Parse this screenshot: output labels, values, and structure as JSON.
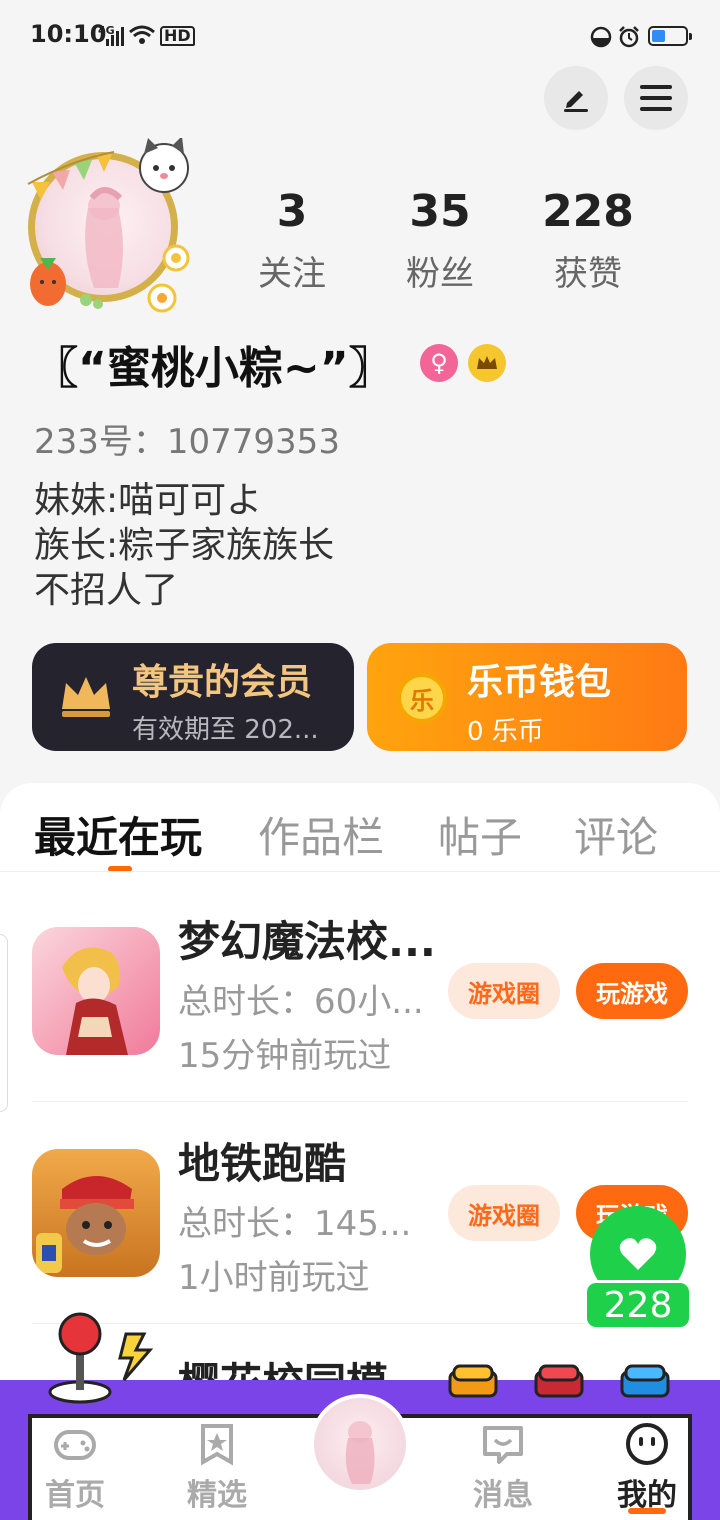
{
  "status_bar": {
    "time": "10:10",
    "network": "4G",
    "hd": "HD",
    "battery_level": 0.4
  },
  "header": {
    "edit_icon": "pencil-icon",
    "menu_icon": "menu-icon"
  },
  "profile": {
    "nickname": "〖“蜜桃小粽~”〗",
    "gender_symbol": "♀",
    "id_text": "233号：10779353",
    "bio": [
      "妹妹:喵可可よ",
      "族长:粽子家族族长",
      "不招人了"
    ],
    "stats": [
      {
        "value": "3",
        "label": "关注"
      },
      {
        "value": "35",
        "label": "粉丝"
      },
      {
        "value": "228",
        "label": "获赞"
      }
    ]
  },
  "cards": {
    "vip": {
      "title": "尊贵的会员",
      "subtitle": "有效期至 202..."
    },
    "wallet": {
      "title": "乐币钱包",
      "subtitle": "0 乐币",
      "coin_glyph": "乐"
    }
  },
  "tabs": [
    {
      "label": "最近在玩",
      "active": true
    },
    {
      "label": "作品栏",
      "active": false
    },
    {
      "label": "帖子",
      "active": false
    },
    {
      "label": "评论",
      "active": false
    }
  ],
  "games": [
    {
      "title": "梦幻魔法校...",
      "duration": "总时长：60小...",
      "last_played": "15分钟前玩过",
      "circle_label": "游戏圈",
      "play_label": "玩游戏"
    },
    {
      "title": "地铁跑酷",
      "duration": "总时长：145...",
      "last_played": "1小时前玩过",
      "circle_label": "游戏圈",
      "play_label": "玩游戏"
    },
    {
      "title": "樱花校园模"
    }
  ],
  "likes_float": {
    "count": "228"
  },
  "bottom_nav": [
    {
      "label": "首页",
      "icon": "gamepad-icon",
      "active": false
    },
    {
      "label": "精选",
      "icon": "star-bookmark-icon",
      "active": false
    },
    {
      "label": "消息",
      "icon": "chat-icon",
      "active": false
    },
    {
      "label": "我的",
      "icon": "smiley-icon",
      "active": true
    }
  ],
  "colors": {
    "accent": "#ff6a10",
    "nav_bar": "#7a44e8",
    "like_green": "#1fd14a",
    "vip_card": "#25232e"
  }
}
